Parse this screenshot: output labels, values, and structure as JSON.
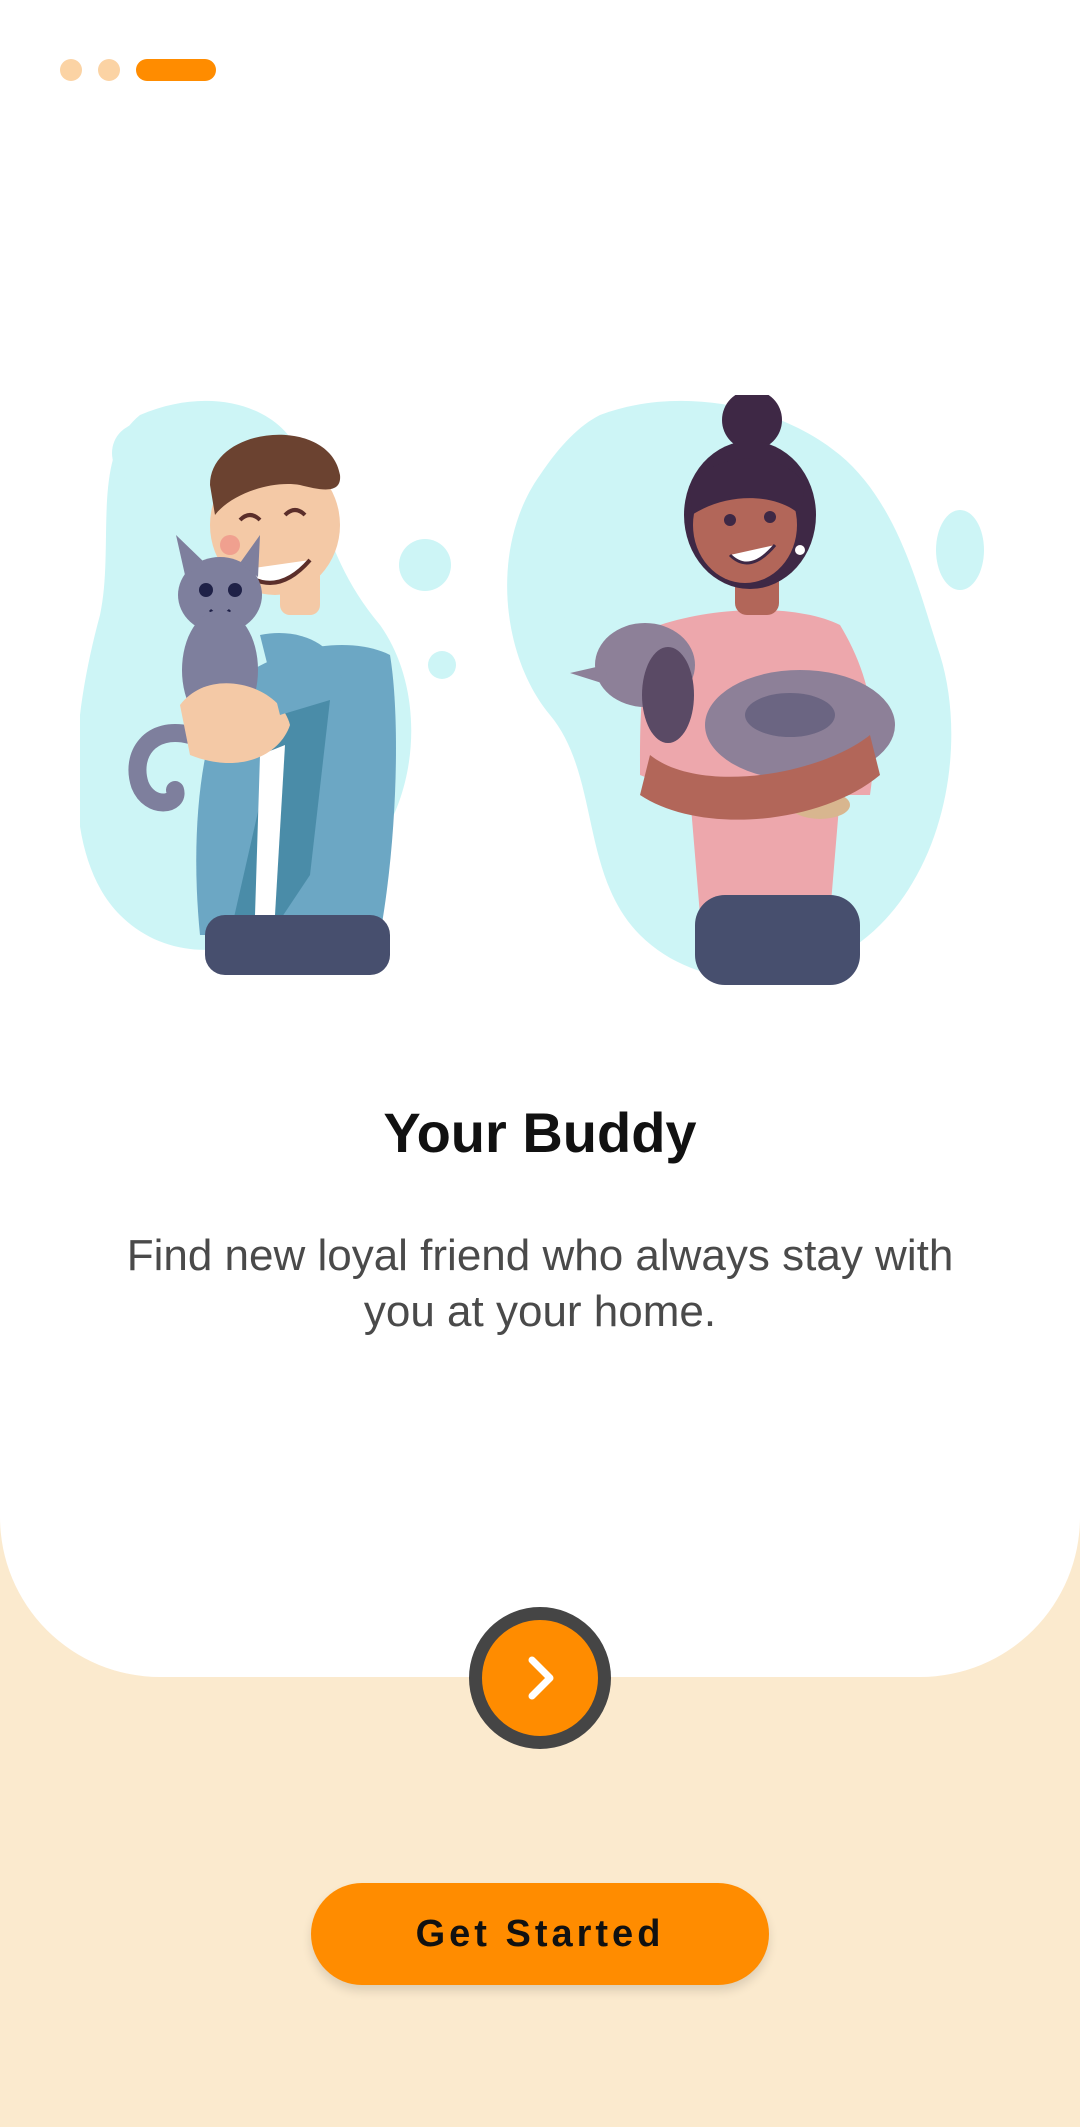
{
  "onboarding": {
    "page_indicator": {
      "total": 3,
      "active_index": 2
    },
    "illustration": "man-with-cat-and-woman-with-dog",
    "title": "Your Buddy",
    "subtitle": "Find new loyal friend who always stay with you at your home.",
    "next_icon": "chevron-right-icon",
    "primary_button": "Get Started"
  },
  "colors": {
    "accent": "#FF8C00",
    "background": "#FBEACE",
    "card": "#FFFFFF",
    "blob": "#CDF5F6"
  }
}
